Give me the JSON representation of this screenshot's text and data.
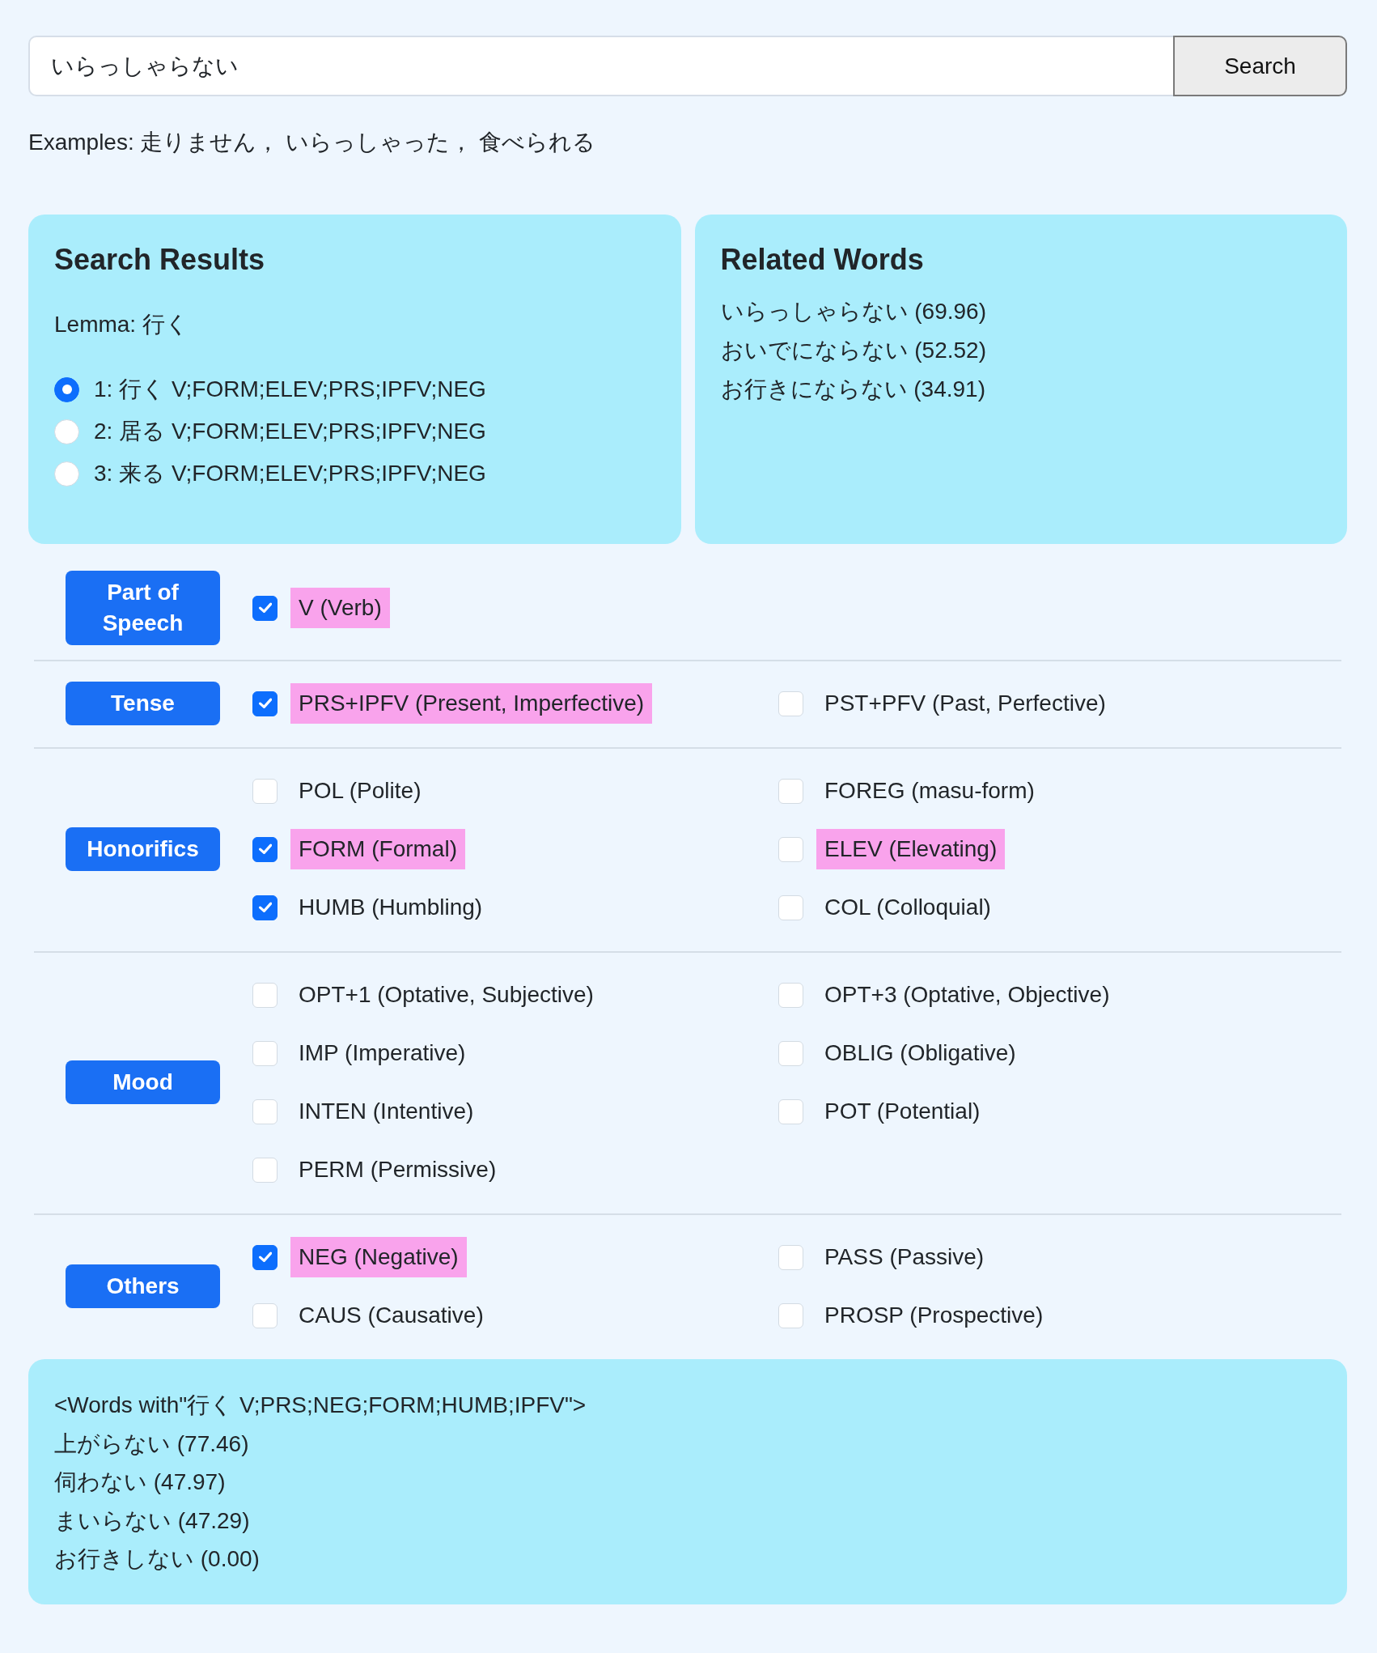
{
  "search": {
    "value": "いらっしゃらない",
    "button": "Search"
  },
  "examples": "Examples: 走りません， いらっしゃった， 食べられる",
  "search_results": {
    "title": "Search Results",
    "lemma": "Lemma: 行く",
    "candidates": [
      {
        "label": "1: 行く V;FORM;ELEV;PRS;IPFV;NEG",
        "selected": true
      },
      {
        "label": "2: 居る V;FORM;ELEV;PRS;IPFV;NEG",
        "selected": false
      },
      {
        "label": "3: 来る V;FORM;ELEV;PRS;IPFV;NEG",
        "selected": false
      }
    ]
  },
  "related_words": {
    "title": "Related Words",
    "items": [
      "いらっしゃらない (69.96)",
      "おいでにならない (52.52)",
      "お行きにならない (34.91)"
    ]
  },
  "categories": [
    {
      "label": "Part of Speech",
      "options": [
        {
          "label": "V (Verb)",
          "checked": true,
          "highlighted": true
        }
      ]
    },
    {
      "label": "Tense",
      "options": [
        {
          "label": "PRS+IPFV (Present, Imperfective)",
          "checked": true,
          "highlighted": true
        },
        {
          "label": "PST+PFV (Past, Perfective)",
          "checked": false,
          "highlighted": false
        }
      ]
    },
    {
      "label": "Honorifics",
      "options": [
        {
          "label": "POL (Polite)",
          "checked": false,
          "highlighted": false
        },
        {
          "label": "FOREG (masu-form)",
          "checked": false,
          "highlighted": false
        },
        {
          "label": "FORM (Formal)",
          "checked": true,
          "highlighted": true
        },
        {
          "label": "ELEV (Elevating)",
          "checked": false,
          "highlighted": true
        },
        {
          "label": "HUMB (Humbling)",
          "checked": true,
          "highlighted": false
        },
        {
          "label": "COL (Colloquial)",
          "checked": false,
          "highlighted": false
        }
      ]
    },
    {
      "label": "Mood",
      "options": [
        {
          "label": "OPT+1 (Optative, Subjective)",
          "checked": false,
          "highlighted": false
        },
        {
          "label": "OPT+3 (Optative, Objective)",
          "checked": false,
          "highlighted": false
        },
        {
          "label": "IMP (Imperative)",
          "checked": false,
          "highlighted": false
        },
        {
          "label": "OBLIG (Obligative)",
          "checked": false,
          "highlighted": false
        },
        {
          "label": "INTEN (Intentive)",
          "checked": false,
          "highlighted": false
        },
        {
          "label": "POT (Potential)",
          "checked": false,
          "highlighted": false
        },
        {
          "label": "PERM (Permissive)",
          "checked": false,
          "highlighted": false
        }
      ]
    },
    {
      "label": "Others",
      "options": [
        {
          "label": "NEG (Negative)",
          "checked": true,
          "highlighted": true
        },
        {
          "label": "PASS (Passive)",
          "checked": false,
          "highlighted": false
        },
        {
          "label": "CAUS (Causative)",
          "checked": false,
          "highlighted": false
        },
        {
          "label": "PROSP (Prospective)",
          "checked": false,
          "highlighted": false
        }
      ]
    }
  ],
  "words": {
    "header": "<Words with\"行く V;PRS;NEG;FORM;HUMB;IPFV\">",
    "items": [
      "上がらない (77.46)",
      "伺わない (47.97)",
      "まいらない (47.29)",
      "お行きしない (0.00)"
    ]
  }
}
